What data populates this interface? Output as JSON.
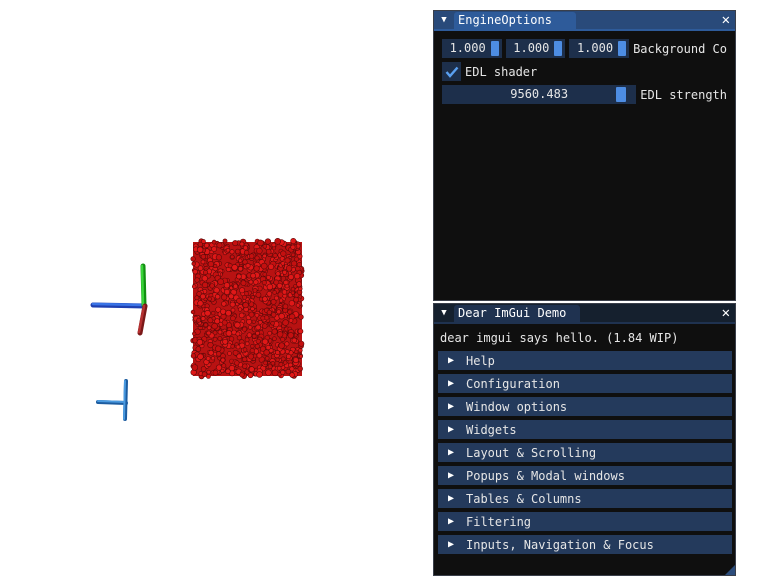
{
  "engine_options": {
    "title": "EngineOptions",
    "bg_r": "1.000",
    "bg_g": "1.000",
    "bg_b": "1.000",
    "bg_label": "Background Co",
    "edl_label": "EDL shader",
    "edl_checked": true,
    "edl_strength_value": "9560.483",
    "edl_strength_label": "EDL strength",
    "collapse_icon": "triangle-down-icon",
    "close_icon": "close-icon"
  },
  "demo": {
    "title": "Dear ImGui Demo",
    "hello": "dear imgui says hello. (1.84 WIP)",
    "headers": [
      {
        "label": "Help"
      },
      {
        "label": "Configuration"
      },
      {
        "label": "Window options"
      },
      {
        "label": "Widgets"
      },
      {
        "label": "Layout & Scrolling"
      },
      {
        "label": "Popups & Modal windows"
      },
      {
        "label": "Tables & Columns"
      },
      {
        "label": "Filtering"
      },
      {
        "label": "Inputs, Navigation & Focus"
      }
    ]
  },
  "colors": {
    "point_cloud": "#cc1111",
    "axis_x": "#2255dd",
    "axis_y": "#22bb22",
    "axis_z": "#aa2222",
    "title_active": "#294a7a",
    "frame_bg": "#1d2f4b",
    "grab": "#4d8de3"
  }
}
